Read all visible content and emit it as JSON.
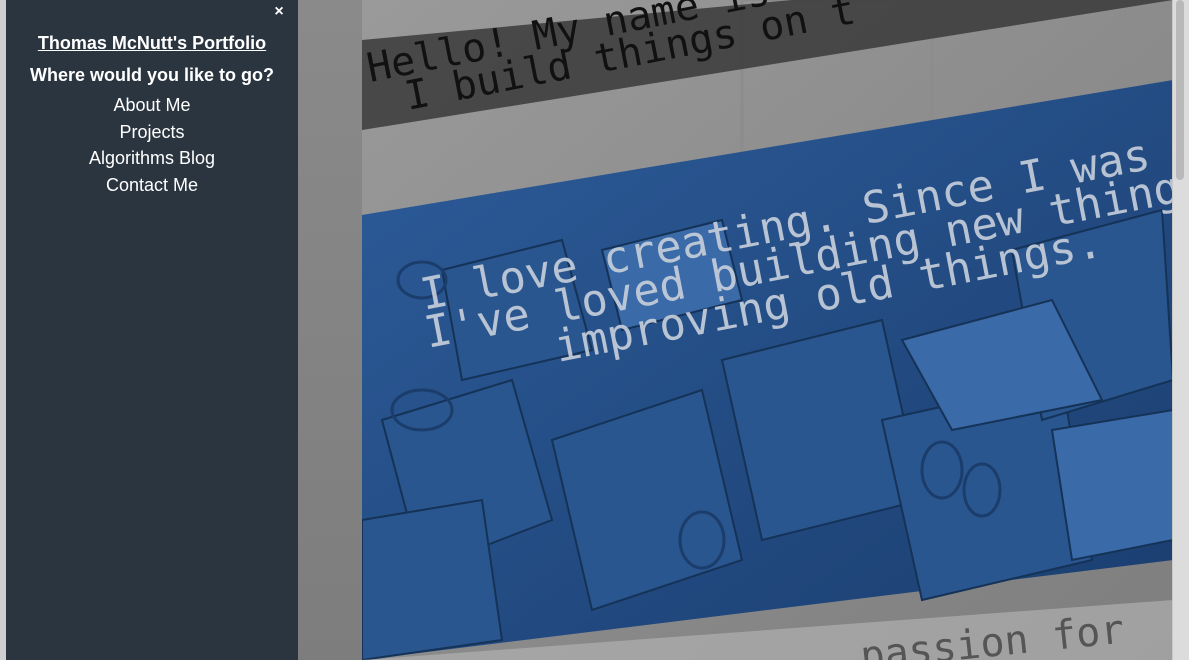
{
  "sidenav": {
    "close_label": "×",
    "title": "Thomas McNutt's Portfolio",
    "prompt": "Where would you like to go?",
    "links": [
      {
        "label": "About Me"
      },
      {
        "label": "Projects"
      },
      {
        "label": "Algorithms Blog"
      },
      {
        "label": "Contact Me"
      }
    ]
  },
  "hero": {
    "banner_line1": "Hello! My name is",
    "banner_line2": "I build things on t",
    "intro_line1": "I love creating. Since I was youn",
    "intro_line2": "I've loved building new things an",
    "intro_line3": "improving old things.",
    "footer_line": "passion for"
  },
  "colors": {
    "sidenav_bg": "#2b3540",
    "hero_blue": "#1f4b86"
  }
}
